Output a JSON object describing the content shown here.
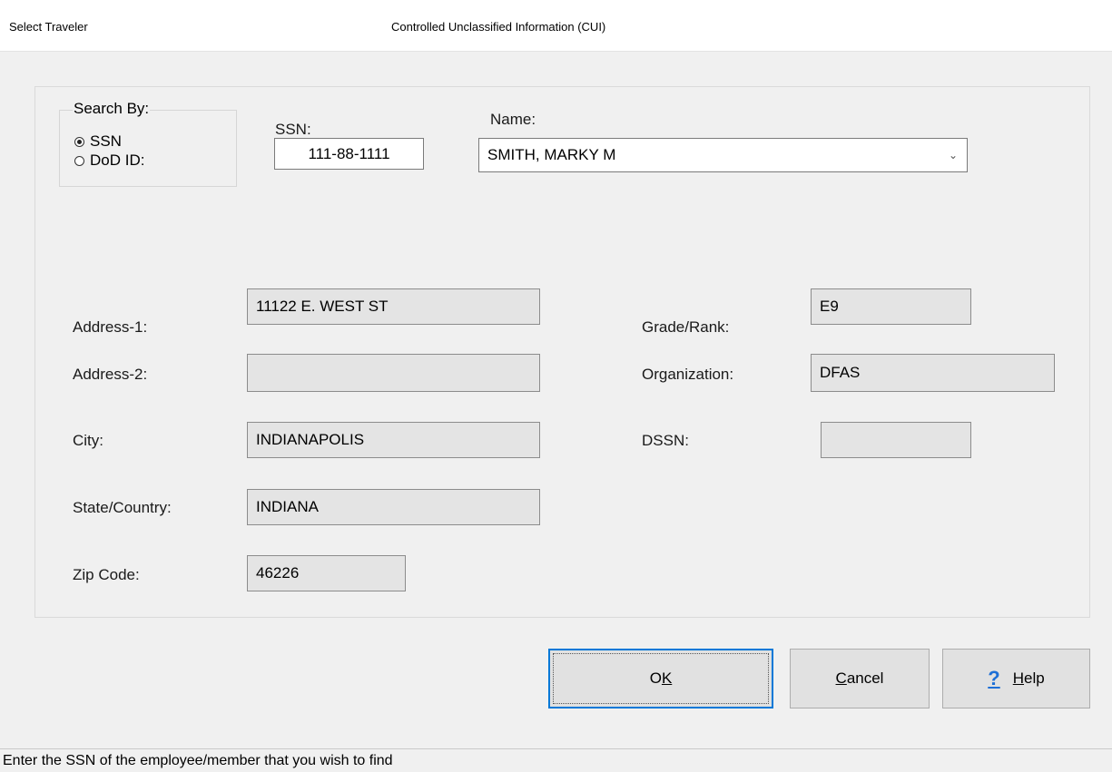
{
  "window": {
    "title": "Select Traveler",
    "classification": "Controlled Unclassified Information (CUI)"
  },
  "search_by": {
    "title": "Search By:",
    "options": [
      {
        "label": "SSN",
        "selected": true
      },
      {
        "label": "DoD ID:",
        "selected": false
      }
    ]
  },
  "ssn": {
    "label": "SSN:",
    "value": "111-88-1111"
  },
  "name": {
    "label": "Name:",
    "value": "SMITH, MARKY M"
  },
  "fields": {
    "address1": {
      "label": "Address-1:",
      "value": "11122 E. WEST ST"
    },
    "address2": {
      "label": "Address-2:",
      "value": ""
    },
    "city": {
      "label": "City:",
      "value": "INDIANAPOLIS"
    },
    "state": {
      "label": "State/Country:",
      "value": "INDIANA"
    },
    "zip": {
      "label": "Zip Code:",
      "value": "46226"
    },
    "grade": {
      "label": "Grade/Rank:",
      "value": "E9"
    },
    "organization": {
      "label": "Organization:",
      "value": "DFAS"
    },
    "dssn": {
      "label": "DSSN:",
      "value": ""
    }
  },
  "buttons": {
    "ok": {
      "pre": "O",
      "accel": "K",
      "post": ""
    },
    "cancel": {
      "pre": "",
      "accel": "C",
      "post": "ancel"
    },
    "help": {
      "pre": "",
      "accel": "H",
      "post": "elp",
      "icon": "question-mark-icon"
    }
  },
  "status": {
    "text": "Enter the SSN of the employee/member that you wish to find"
  }
}
